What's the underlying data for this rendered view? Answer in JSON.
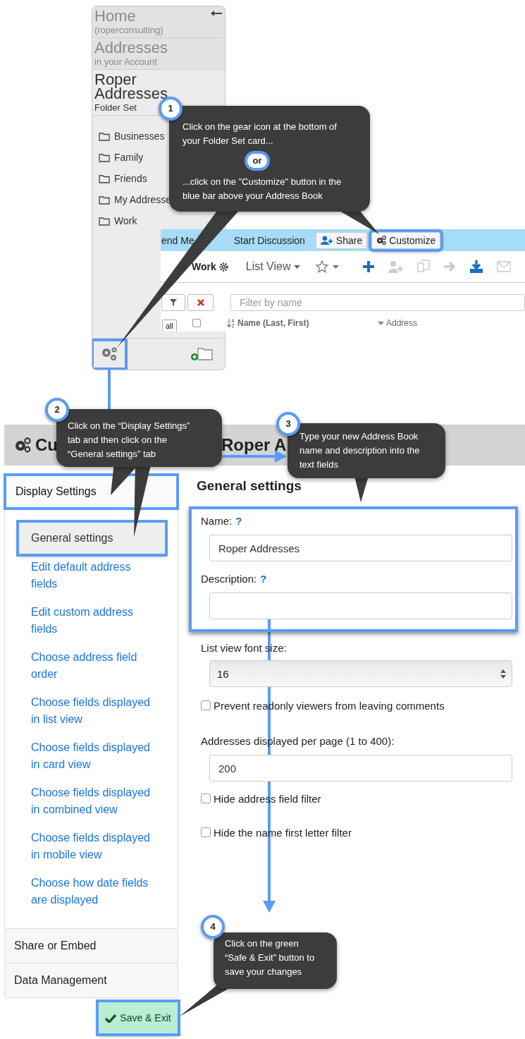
{
  "folder_set_card": {
    "sections": [
      {
        "title": "Home",
        "subtitle": "(roperconsulting)",
        "selected": false
      },
      {
        "title": "Addresses",
        "subtitle": "in your Account",
        "selected": false
      },
      {
        "title": "Roper Addresses",
        "subtitle": "Folder Set",
        "selected": true
      }
    ],
    "folders": [
      "Businesses",
      "Family",
      "Friends",
      "My Addresse",
      "Work"
    ],
    "settings_highlighted": true
  },
  "address_book": {
    "blue_bar": [
      {
        "label": "end Me",
        "kind": "link",
        "highlighted": false
      },
      {
        "label": "Start Discussion",
        "kind": "link",
        "highlighted": false
      },
      {
        "label": "Share",
        "kind": "share-button",
        "highlighted": false
      },
      {
        "label": "Customize",
        "kind": "customize-button",
        "highlighted": true
      }
    ],
    "folder_name": "Work",
    "view": "List View",
    "toolbar_buttons": [
      {
        "kind": "add",
        "disabled": false
      },
      {
        "kind": "add-user",
        "disabled": true
      },
      {
        "kind": "copy",
        "disabled": true
      },
      {
        "kind": "move",
        "disabled": true
      },
      {
        "kind": "download",
        "disabled": false
      },
      {
        "kind": "mail",
        "disabled": true
      }
    ],
    "filter_placeholder": "Filter by name",
    "letter_button": "all",
    "select_all_checked": false,
    "columns": [
      {
        "label": "Name (Last, First)",
        "sorted": true
      },
      {
        "label": "Address",
        "sorted": false
      }
    ]
  },
  "customize": {
    "title_parts": [
      "Cu",
      "Roper A"
    ],
    "nav": [
      {
        "label": "Display Settings",
        "selected": true,
        "highlighted": true,
        "children": [
          {
            "label": "General settings",
            "selected": true,
            "highlighted": true
          },
          {
            "label": "Edit default address fields",
            "selected": false,
            "highlighted": false
          },
          {
            "label": "Edit custom address fields",
            "selected": false,
            "highlighted": false
          },
          {
            "label": "Choose address field order",
            "selected": false,
            "highlighted": false
          },
          {
            "label": "Choose fields displayed in list view",
            "selected": false,
            "highlighted": false
          },
          {
            "label": "Choose fields displayed in card view",
            "selected": false,
            "highlighted": false
          },
          {
            "label": "Choose fields displayed in combined view",
            "selected": false,
            "highlighted": false
          },
          {
            "label": "Choose fields displayed in mobile view",
            "selected": false,
            "highlighted": false
          },
          {
            "label": "Choose how date fields are displayed",
            "selected": false,
            "highlighted": false
          }
        ]
      },
      {
        "label": "Share or Embed",
        "selected": false,
        "highlighted": false
      },
      {
        "label": "Data Management",
        "selected": false,
        "highlighted": false
      }
    ],
    "heading": "General settings",
    "highlighted_fields": [
      {
        "kind": "text",
        "label": "Name:",
        "help": "?",
        "value": "Roper Addresses"
      },
      {
        "kind": "text",
        "label": "Description:",
        "help": "?"
      }
    ],
    "fields": [
      {
        "kind": "select",
        "label": "List view font size:",
        "value": "16"
      },
      {
        "kind": "checkbox",
        "label": "Prevent readonly viewers from leaving comments",
        "checked": false
      },
      {
        "kind": "text",
        "label": "Addresses displayed per page (1 to 400):",
        "value": "200"
      },
      {
        "kind": "checkbox",
        "label": "Hide address field filter",
        "checked": false
      },
      {
        "kind": "checkbox",
        "label": "Hide the name first letter filter",
        "checked": false
      }
    ],
    "save_button": {
      "label": "Save & Exit",
      "highlighted": true
    }
  },
  "callouts": [
    {
      "step": "1",
      "paragraphs": [
        "Click on the gear icon at the bottom of your Folder Set card...",
        "...click on the \"Customize\" button in the blue bar above your Address Book"
      ],
      "separator": "or"
    },
    {
      "step": "2",
      "paragraphs": [
        "Click on the “Display Settings” tab and then click on the “General settings” tab"
      ]
    },
    {
      "step": "3",
      "paragraphs": [
        "Type your new Address Book name and description into the text fields"
      ]
    },
    {
      "step": "4",
      "paragraphs": [
        "Click on the green “Safe & Exit” button to save your changes"
      ]
    }
  ]
}
